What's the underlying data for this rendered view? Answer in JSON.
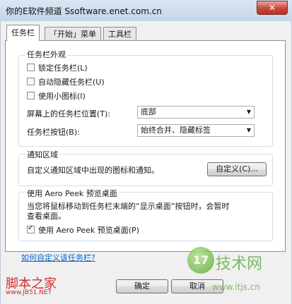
{
  "window": {
    "title": "你的E软件频道 Ssoftware.enet.com.cn",
    "close_glyph": "✕"
  },
  "tabs": [
    {
      "label": "任务栏"
    },
    {
      "label": "「开始」菜单"
    },
    {
      "label": "工具栏"
    }
  ],
  "appearance": {
    "heading": "任务栏外观",
    "lock": {
      "label": "锁定任务栏(L)",
      "checked": false
    },
    "autohide": {
      "label": "自动隐藏任务栏(U)",
      "checked": false
    },
    "small_icons": {
      "label": "使用小图标(I)",
      "checked": false
    },
    "location_label": "屏幕上的任务栏位置(T):",
    "location_value": "底部",
    "buttons_label": "任务栏按钮(B):",
    "buttons_value": "始终合并、隐藏标签"
  },
  "notification": {
    "heading": "通知区域",
    "description": "自定义通知区域中出现的图标和通知。",
    "customize_button": "自定义(C)..."
  },
  "peek": {
    "heading": "使用 Aero Peek 预览桌面",
    "description_line1": "当您将鼠标移动到任务栏末端的“显示桌面”按钮时，会暂时",
    "description_line2": "查看桌面。",
    "checkbox_label": "使用 Aero Peek 预览桌面(P)",
    "checked": true
  },
  "help_link": "如何自定义该任务栏?",
  "footer": {
    "ok": "确定",
    "cancel": "取消"
  },
  "watermarks": {
    "jb51_name": "脚本之家",
    "jb51_url": "www.JB51.NET",
    "brand_mark": "17",
    "brand_name": "技术网",
    "brand_url": "www.itjs.cn"
  }
}
